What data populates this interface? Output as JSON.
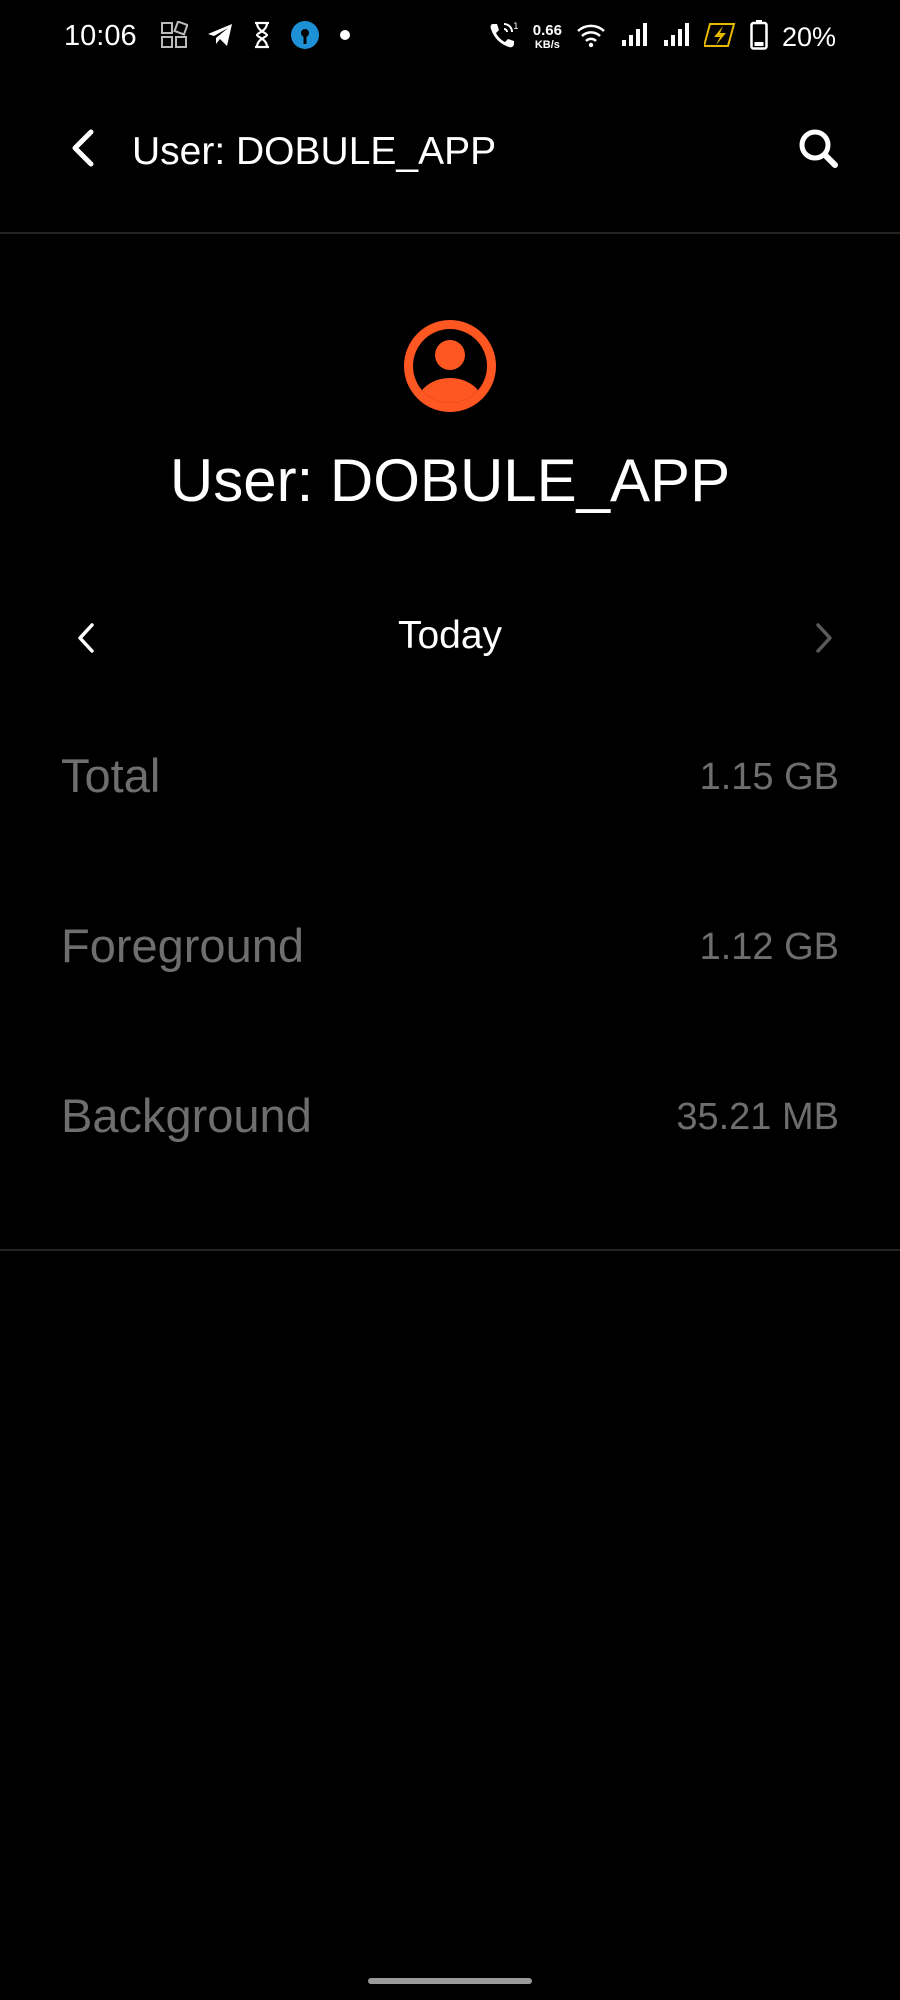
{
  "status_bar": {
    "time": "10:06",
    "left_icons": [
      "gallery-grid-icon",
      "telegram-icon",
      "hourglass-icon",
      "sbi-app-icon",
      "notification-dot-icon"
    ],
    "network_speed_value": "0.66",
    "network_speed_unit": "KB/s",
    "right_icons": [
      "volte-call-icon",
      "wifi-icon",
      "signal-sim1-icon",
      "signal-sim2-icon",
      "charging-bolt-icon",
      "battery-icon"
    ],
    "battery_percent": "20%"
  },
  "app_bar": {
    "title": "User: DOBULE_APP",
    "back_icon": "back-arrow-icon",
    "search_icon": "search-icon"
  },
  "header": {
    "avatar_icon": "user-avatar-icon",
    "title": "User: DOBULE_APP",
    "accent_color": "#FF5722"
  },
  "date_selector": {
    "label": "Today",
    "prev_icon": "chevron-left-icon",
    "next_icon": "chevron-right-icon"
  },
  "stats": [
    {
      "label": "Total",
      "value": "1.15 GB"
    },
    {
      "label": "Foreground",
      "value": "1.12 GB"
    },
    {
      "label": "Background",
      "value": "35.21 MB"
    }
  ]
}
